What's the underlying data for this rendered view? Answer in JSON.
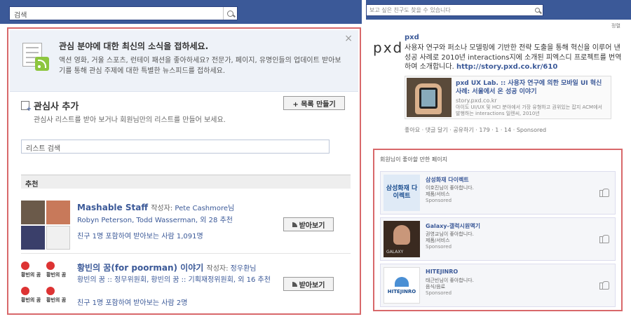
{
  "left": {
    "search_value": "검색",
    "notice": {
      "title": "관심 분야에 대한 최신의 소식을 접하세요.",
      "body": "액션 영화, 거울 스포츠, 런테이 패션을 좋아하세요? 전문가, 페이지, 유명인들의 업데이트 받아보기를 통해 관심 주제에 대한 특별한 뉴스피드를 접하세요.",
      "close": "×"
    },
    "add": {
      "title": "관심사 추가",
      "desc": "관심사 리스트를 받아 보거나 회원님만의 리스트를 만들어 보세요.",
      "make_button": "+ 목록 만들기"
    },
    "list_search_value": "리스트 검색",
    "recommend_header": "추천",
    "items": [
      {
        "name": "Mashable Staff",
        "by_label": "작성자:",
        "author": "Pete Cashmore님",
        "members": "Robyn Peterson, Todd Wasserman, 외 28 추천",
        "meta": "친구 1명 포함하여 받아보는 사람 1,091명",
        "button": "받아보기"
      },
      {
        "name": "황빈의 꿈(for poorman) 이야기",
        "by_label": "작성자:",
        "author": "정우환님",
        "members": "황빈의 꿈 :: 정무위원회, 황빈의 꿈 :: 기획재정위원회, 외 16 추천",
        "meta": "친구 1명 포함하여 받아보는 사람 2명",
        "button": "받아보기",
        "stamp_text": "황빈의 꿈"
      }
    ]
  },
  "right": {
    "search_placeholder": "보고 싶은 친구도 찾을 수 있습니다",
    "sort_label": "정렬",
    "ad": {
      "logo": "pxd",
      "title": "pxd",
      "desc": "사용자 연구와 퍼소나 모델링에 기반한 전략 도출을 통해 혁신을 이루어 낸 성공 사례로 2010년 interactions지에 소개된 피엑스디 프로젝트를 번역하여 소개합니다.",
      "link": "http://story.pxd.co.kr/610",
      "link_title": "pxd UX Lab. :: 사용자 연구에 의한 모바일 UI 혁신 사례: 서울에서 온 성공 이야기",
      "link_domain": "story.pxd.co.kr",
      "link_excerpt": "아이도 UI/UX 및 HCI 분야에서 가장 유형하고 권위있는 잡지 ACM에서 발행하는 interactions 일렌씨, 2010년",
      "actions": "좋아요 · 댓글 달기 · 공유하기 · 179 · 1 · 14 · Sponsored",
      "like_count": "179",
      "comment_count": "1",
      "share_count": "14"
    },
    "pages": {
      "header": "회원님이 좋아할 만한 페이지",
      "rows": [
        {
          "logo_text": "삼성화재 다이렉트",
          "title": "삼성화재 다이렉트",
          "line1": "이호진님이 좋아합니다.",
          "line2": "제품/서비스",
          "sponsored": "Sponsored"
        },
        {
          "logo_text": "GALAXY",
          "title": "Galaxy-갤럭시원액기",
          "line1": "권영교님이 좋아합니다.",
          "line2": "제품/서비스",
          "sponsored": "Sponsored"
        },
        {
          "logo_text": "HITEJINRO",
          "title": "HITEJINRO",
          "line1": "태근빈님이 좋아합니다.",
          "line2": "음식/음료",
          "sponsored": "Sponsored"
        }
      ]
    }
  }
}
